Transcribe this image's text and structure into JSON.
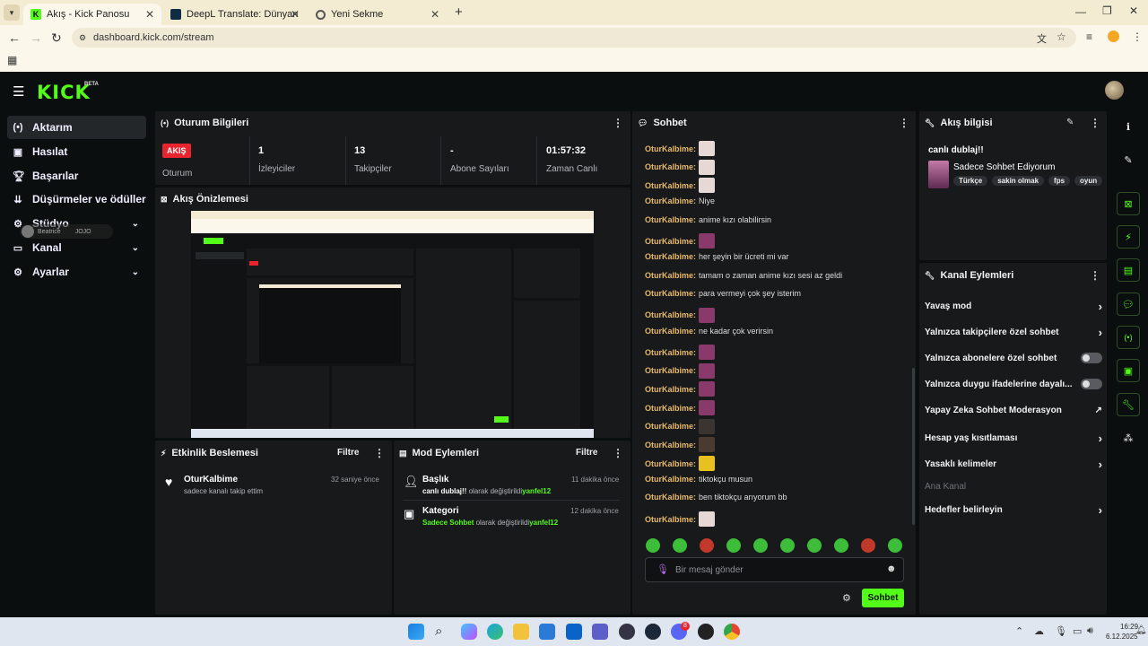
{
  "browser": {
    "tabs": [
      {
        "title": "Akış - Kick Panosu"
      },
      {
        "title": "DeepL Translate: Dünyanın en i"
      },
      {
        "title": "Yeni Sekme"
      }
    ],
    "url": "dashboard.kick.com/stream",
    "new_tab": "+"
  },
  "app": {
    "logo": "KICK",
    "beta": "BETA"
  },
  "sidebar": {
    "items": [
      {
        "label": "Aktarım",
        "icon": "broadcast-icon"
      },
      {
        "label": "Hasılat",
        "icon": "revenue-icon"
      },
      {
        "label": "Başarılar",
        "icon": "trophy-icon"
      },
      {
        "label": "Düşürmeler ve ödüller",
        "icon": "drops-icon"
      },
      {
        "label": "Stüdyo",
        "icon": "studio-icon"
      },
      {
        "label": "Kanal",
        "icon": "channel-icon"
      },
      {
        "label": "Ayarlar",
        "icon": "gear-icon"
      }
    ],
    "overlay_user": "Beatrice",
    "overlay_badge": "JOJO"
  },
  "session": {
    "title": "Oturum Bilgileri",
    "live_badge": "AKIŞ",
    "live_label": "Oturum",
    "stats": [
      {
        "value": "1",
        "label": "İzleyiciler"
      },
      {
        "value": "13",
        "label": "Takipçiler"
      },
      {
        "value": "-",
        "label": "Abone Sayıları"
      },
      {
        "value": "01:57:32",
        "label": "Zaman Canlı"
      }
    ]
  },
  "preview": {
    "title": "Akış Önizlemesi"
  },
  "activity": {
    "title": "Etkinlik Beslemesi",
    "filter": "Filtre",
    "items": [
      {
        "user": "OturKalbime",
        "text": "sadece kanalı takip ettim",
        "time": "32 saniye önce"
      }
    ]
  },
  "mod": {
    "title": "Mod Eylemleri",
    "filter": "Filtre",
    "items": [
      {
        "heading": "Başlık",
        "value": "canlı dublaj!!",
        "mid": " olarak değiştirildi",
        "user": "yanfel12",
        "time": "11 dakika önce"
      },
      {
        "heading": "Kategori",
        "value": "Sadece Sohbet",
        "mid": " olarak değiştirildi",
        "user": "yanfel12",
        "time": "12 dakika önce"
      }
    ]
  },
  "chat": {
    "title": "Sohbet",
    "username": "OturKalbime:",
    "messages": [
      "",
      "",
      "",
      "Niye",
      "anime kızı olabilirsin",
      "",
      "her şeyin bir ücreti mi var",
      "tamam o zaman anime kızı sesi az geldi",
      "para vermeyi çok şey isterim",
      "",
      "ne kadar çok verirsin",
      "",
      "",
      "",
      "",
      "",
      "",
      "",
      "tiktokçu musun",
      "ben tiktokçu arıyorum bb",
      ""
    ],
    "placeholder": "Bir mesaj gönder",
    "send": "Sohbet"
  },
  "stream_info": {
    "title": "Akış bilgisi",
    "stream_title": "canlı dublaj!!",
    "category": "Sadece Sohbet Ediyorum",
    "tags": [
      "Türkçe",
      "sakin olmak",
      "fps",
      "oyun"
    ]
  },
  "channel_actions": {
    "title": "Kanal Eylemleri",
    "items": [
      {
        "label": "Yavaş mod",
        "kind": "chevron"
      },
      {
        "label": "Yalnızca takipçilere özel sohbet",
        "kind": "chevron"
      },
      {
        "label": "Yalnızca abonelere özel sohbet",
        "kind": "toggle"
      },
      {
        "label": "Yalnızca duygu ifadelerine dayalı...",
        "kind": "toggle"
      },
      {
        "label": "Yapay Zeka Sohbet Moderasyon",
        "kind": "external"
      },
      {
        "label": "Hesap yaş kısıtlaması",
        "kind": "chevron"
      },
      {
        "label": "Yasaklı kelimeler",
        "kind": "chevron"
      }
    ],
    "section": "Ana Kanal",
    "goals": "Hedefler belirleyin"
  },
  "taskbar": {
    "time": "16:29",
    "date": "6.12.2025",
    "discord_badge": "8"
  },
  "colors": {
    "accent": "#53fc18",
    "username": "#e8b96c",
    "live": "#e8242f"
  }
}
